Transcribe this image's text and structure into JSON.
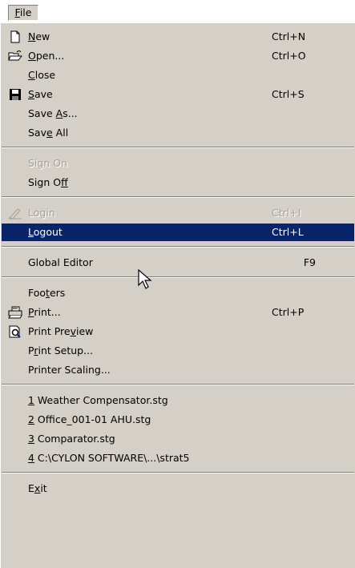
{
  "menubar": {
    "file": {
      "pre": "",
      "u": "F",
      "post": "ile"
    }
  },
  "menu": {
    "new": {
      "pre": "",
      "u": "N",
      "post": "ew",
      "shortcut": "Ctrl+N",
      "icon": "new-document-icon"
    },
    "open": {
      "pre": "",
      "u": "O",
      "post": "pen...",
      "shortcut": "Ctrl+O",
      "icon": "open-folder-icon"
    },
    "close": {
      "pre": "",
      "u": "C",
      "post": "lose"
    },
    "save": {
      "pre": "",
      "u": "S",
      "post": "ave",
      "shortcut": "Ctrl+S",
      "icon": "floppy-disk-icon"
    },
    "save_as": {
      "pre": "Save ",
      "u": "A",
      "post": "s..."
    },
    "save_all": {
      "pre": "Sav",
      "u": "e",
      "post": " All"
    },
    "sign_on": {
      "pre": "Si",
      "u": "g",
      "post": "n On"
    },
    "sign_off": {
      "pre": "Sign O",
      "u": "f",
      "post": "f"
    },
    "login": {
      "pre": "Lo",
      "u": "g",
      "post": "in",
      "shortcut": "Ctrl+I",
      "icon": "pen-icon"
    },
    "logout": {
      "pre": "",
      "u": "L",
      "post": "ogout",
      "shortcut": "Ctrl+L"
    },
    "global_editor": {
      "label": "Global Editor",
      "shortcut": "F9"
    },
    "footers": {
      "pre": "Foo",
      "u": "t",
      "post": "ers"
    },
    "print": {
      "pre": "",
      "u": "P",
      "post": "rint...",
      "shortcut": "Ctrl+P",
      "icon": "printer-icon"
    },
    "print_preview": {
      "pre": "Print Pre",
      "u": "v",
      "post": "iew",
      "icon": "print-preview-icon"
    },
    "print_setup": {
      "pre": "P",
      "u": "r",
      "post": "int Setup..."
    },
    "printer_scaling": {
      "label": "Printer Scaling..."
    },
    "recent": [
      {
        "u": "1",
        "post": " Weather Compensator.stg"
      },
      {
        "u": "2",
        "post": " Office_001-01 AHU.stg"
      },
      {
        "u": "3",
        "post": " Comparator.stg"
      },
      {
        "u": "4",
        "post": " C:\\CYLON SOFTWARE\\...\\strat5"
      }
    ],
    "exit": {
      "pre": "E",
      "u": "x",
      "post": "it"
    }
  },
  "colors": {
    "menu_bg": "#d4d0c8",
    "highlight": "#0a246a",
    "disabled": "#a4a09a"
  }
}
